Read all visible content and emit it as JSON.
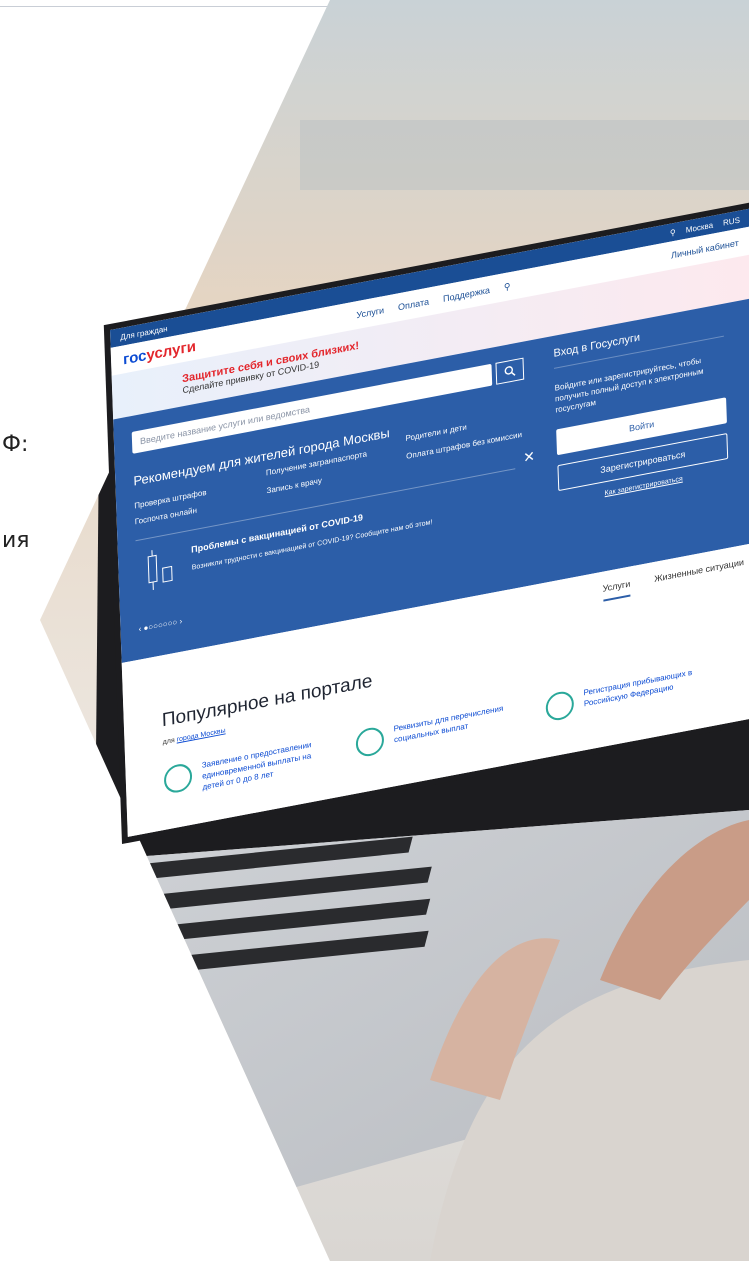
{
  "page": {
    "left_glyph_1": "Ф:",
    "left_glyph_2": "ия"
  },
  "screen": {
    "topbar": {
      "audience": "Для граждан",
      "city": "Москва",
      "lang": "RUS"
    },
    "header": {
      "logo_a": "гос",
      "logo_b": "услуги",
      "nav": [
        "Услуги",
        "Оплата",
        "Поддержка"
      ],
      "cabinet": "Личный кабинет"
    },
    "banner": {
      "title": "Защитите себя и своих близких!",
      "subtitle": "Сделайте прививку от COVID-19"
    },
    "search": {
      "placeholder": "Введите название услуги или ведомства"
    },
    "recommend": {
      "title": "Рекомендуем для жителей города Москвы",
      "links": [
        "Проверка штрафов",
        "Получение загранпаспорта",
        "Родители и дети",
        "Госпочта онлайн",
        "Запись к врачу",
        "Оплата штрафов без комиссии"
      ]
    },
    "problem": {
      "title": "Проблемы с вакцинацией от COVID-19",
      "text": "Возникли трудности с вакцинацией от COVID-19? Сообщите нам об этом!"
    },
    "login": {
      "title": "Вход в Госуслуги",
      "text": "Войдите или зарегистрируйтесь, чтобы получить полный доступ к электронным госуслугам",
      "login_btn": "Войти",
      "register_btn": "Зарегистрироваться",
      "how_link": "Как зарегистрироваться"
    },
    "tabs": [
      "Услуги",
      "Жизненные ситуации"
    ],
    "popular": {
      "title": "Популярное на портале",
      "sub_prefix": "для",
      "sub_link": "города Москвы",
      "cards": [
        "Заявление о предоставлении единовременной выплаты на детей от 0 до 8 лет",
        "Реквизиты для перечисления социальных выплат",
        "Регистрация прибывающих в Российскую Федерацию"
      ]
    }
  },
  "colors": {
    "brand_blue": "#2c5ea8",
    "brand_red": "#e3262c"
  }
}
